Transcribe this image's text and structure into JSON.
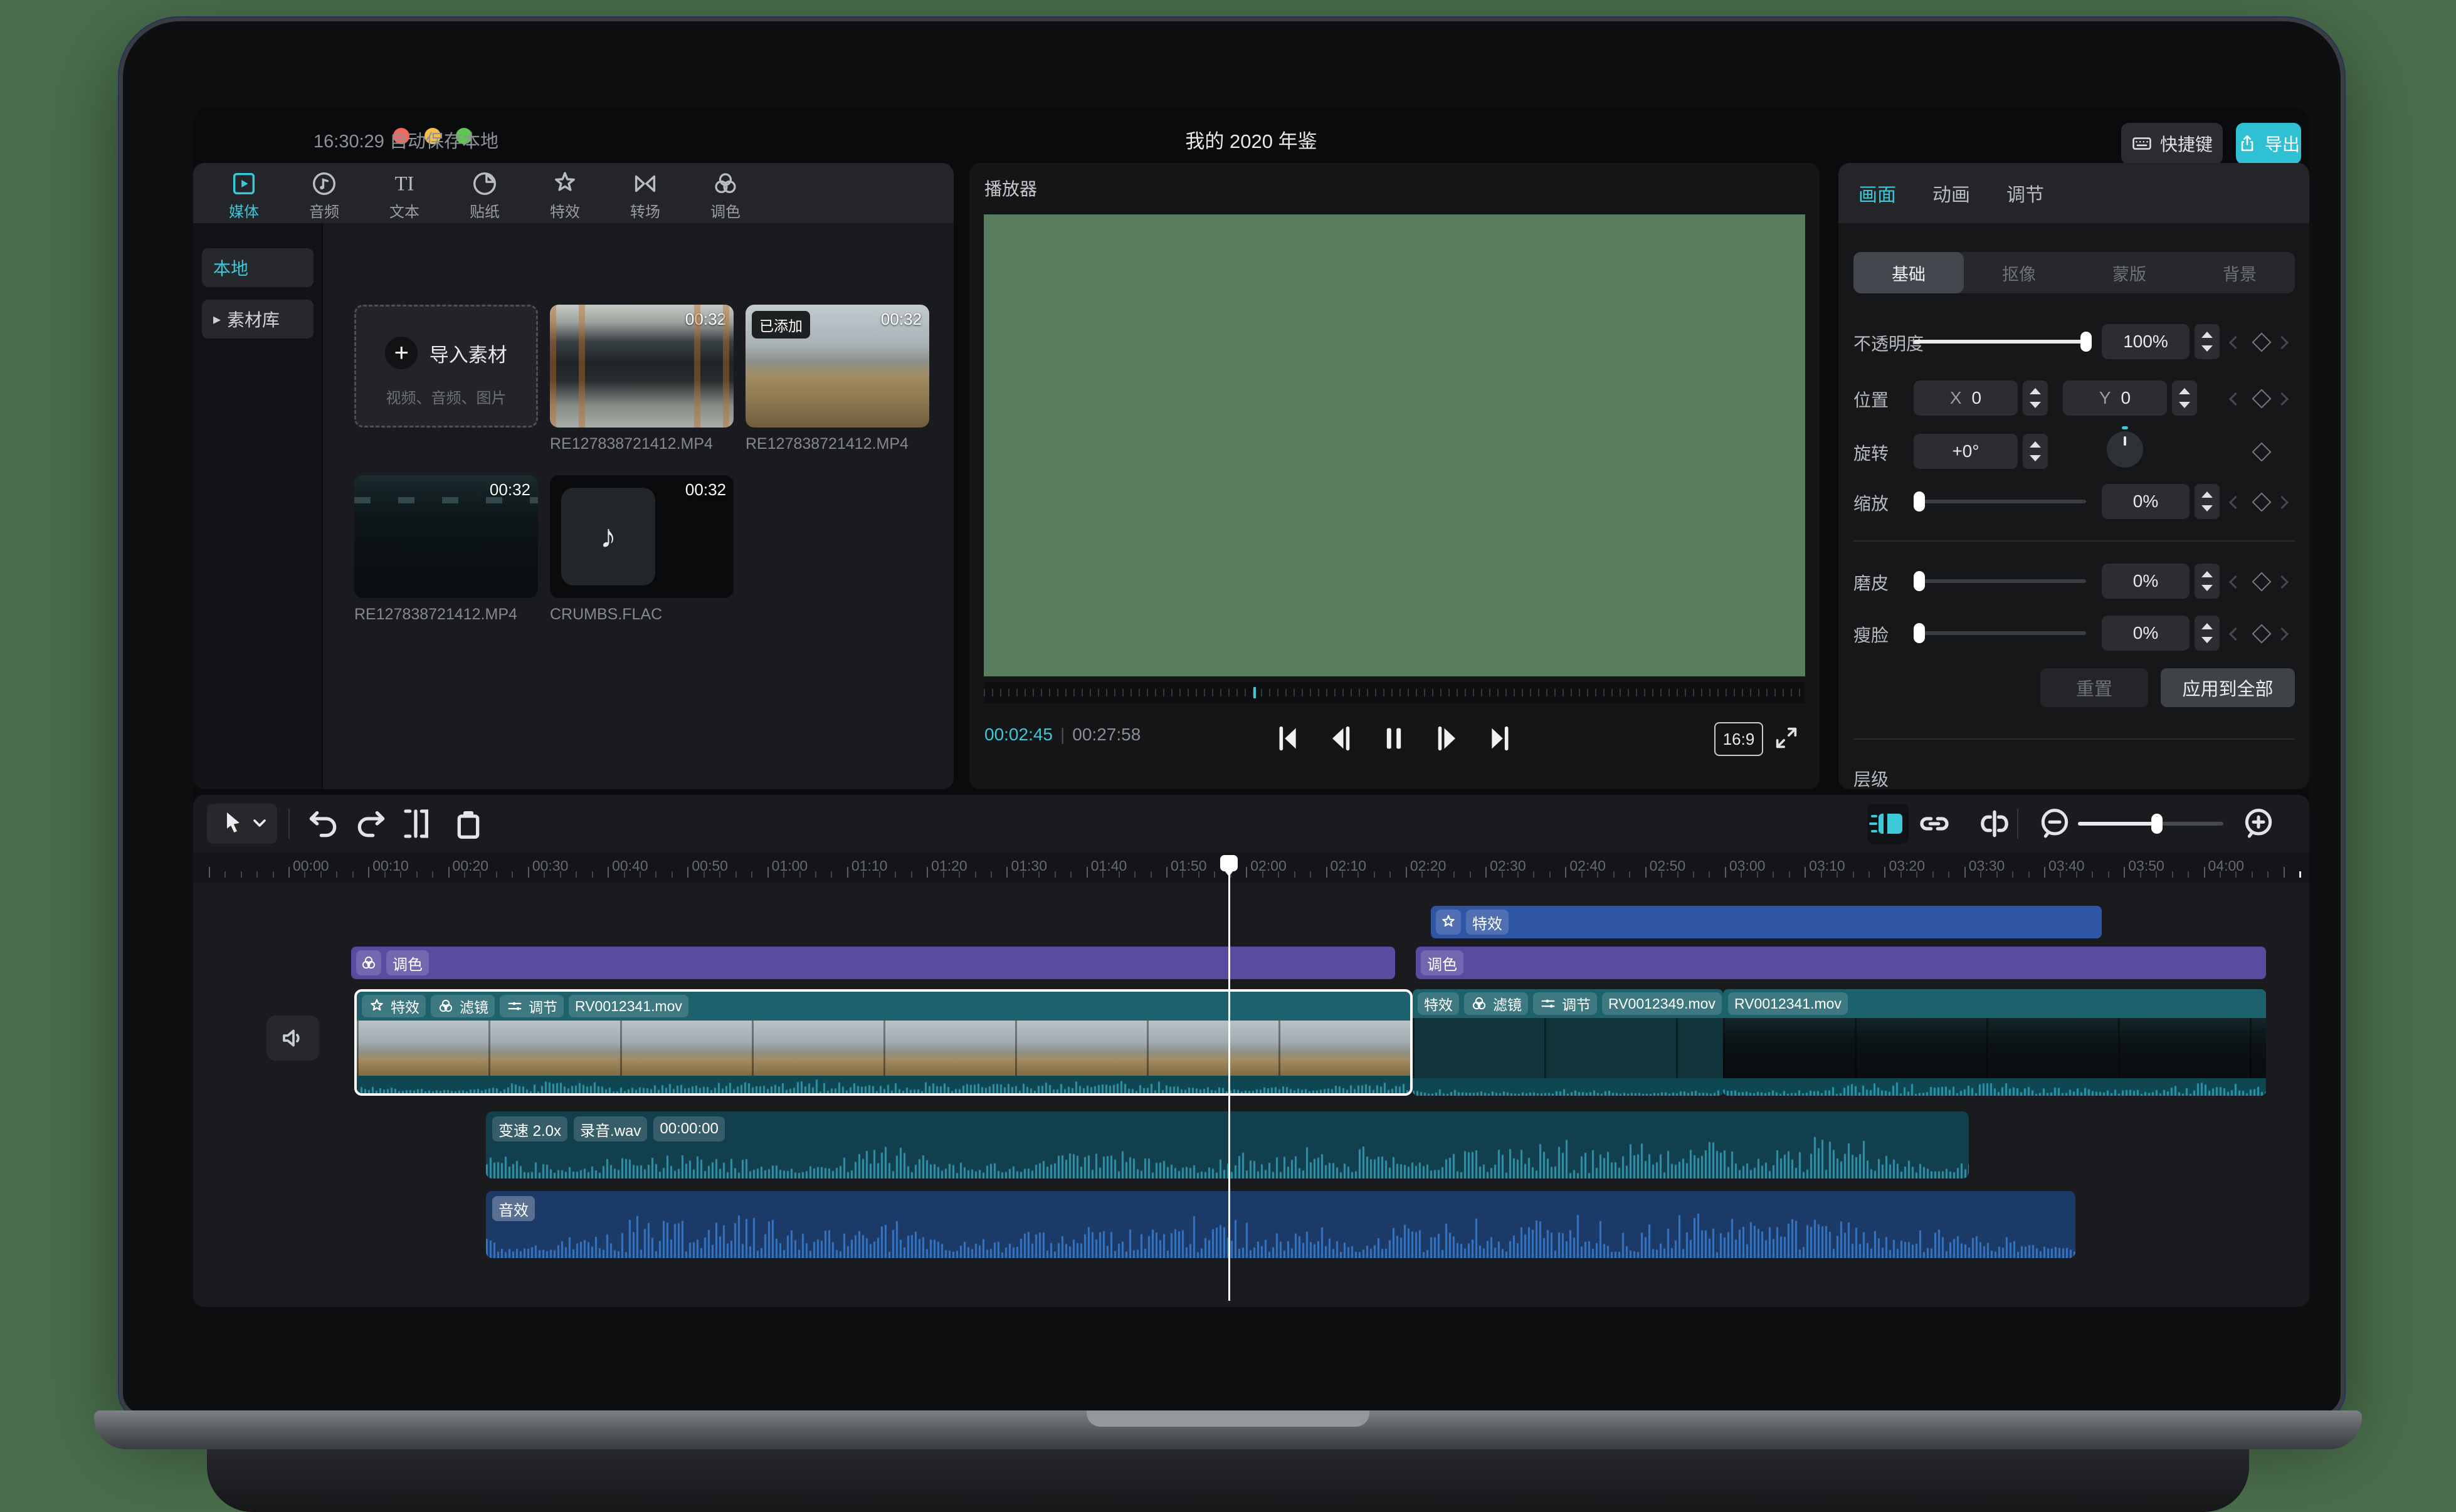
{
  "app": {
    "accent": "#3bc8d8",
    "background": "#4a6e4c"
  },
  "titlebar": {
    "autosave": "16:30:29 自动保存本地",
    "title": "我的 2020 年鉴",
    "shortcuts": {
      "icon": "keyboard-icon",
      "label": "快捷键"
    },
    "export": {
      "icon": "share-up-icon",
      "label": "导出"
    }
  },
  "media": {
    "tabs": [
      {
        "icon": "play-icon",
        "label": "媒体",
        "active": true
      },
      {
        "icon": "music-icon",
        "label": "音频"
      },
      {
        "icon": "text-icon",
        "label": "文本"
      },
      {
        "icon": "sticker-icon",
        "label": "贴纸"
      },
      {
        "icon": "fx-star-icon",
        "label": "特效"
      },
      {
        "icon": "transition-icon",
        "label": "转场"
      },
      {
        "icon": "color-wheels-icon",
        "label": "调色"
      }
    ],
    "sidebar": [
      {
        "label": "本地",
        "active": true
      },
      {
        "label": "素材库",
        "arrow": true
      }
    ],
    "import_card": {
      "icon": "plus-icon",
      "label": "导入素材",
      "hint": "视频、音频、图片"
    },
    "items": [
      {
        "kind": "video",
        "variant": "tunnel",
        "duration": "00:32",
        "name": "RE127838721412.MP4"
      },
      {
        "kind": "video",
        "variant": "flood",
        "duration": "00:32",
        "name": "RE127838721412.MP4",
        "added_badge": "已添加"
      },
      {
        "kind": "video",
        "variant": "garage",
        "duration": "00:32",
        "name": "RE127838721412.MP4"
      },
      {
        "kind": "audio",
        "variant": "audio",
        "duration": "00:32",
        "name": "CRUMBS.FLAC",
        "icon": "music-note-icon",
        "note_glyph": "♪"
      }
    ]
  },
  "player": {
    "title": "播放器",
    "current_time": "00:02:45",
    "total_time": "00:27:58",
    "aspect_ratio": "16:9",
    "transport_icons": [
      "skip-start-icon",
      "prev-frame-icon",
      "pause-icon",
      "next-frame-icon",
      "skip-end-icon"
    ],
    "preview_color": "#587e5e"
  },
  "inspector": {
    "tabs": [
      {
        "label": "画面",
        "active": true
      },
      {
        "label": "动画"
      },
      {
        "label": "调节"
      }
    ],
    "subtabs": [
      {
        "label": "基础",
        "active": true
      },
      {
        "label": "抠像"
      },
      {
        "label": "蒙版"
      },
      {
        "label": "背景"
      }
    ],
    "opacity": {
      "label": "不透明度",
      "value": "100%",
      "slider_pct": 100
    },
    "position": {
      "label": "位置",
      "x_label": "X",
      "x_value": "0",
      "y_label": "Y",
      "y_value": "0"
    },
    "rotation": {
      "label": "旋转",
      "value": "+0°"
    },
    "scale": {
      "label": "缩放",
      "value": "0%",
      "slider_pct": 0
    },
    "smooth_skin": {
      "label": "磨皮",
      "value": "0%",
      "slider_pct": 0
    },
    "slim_face": {
      "label": "瘦脸",
      "value": "0%",
      "slider_pct": 0
    },
    "reset_btn": "重置",
    "apply_all_btn": "应用到全部",
    "layer_label": "层级"
  },
  "timeline": {
    "toolbar_icons": [
      "cursor-icon",
      "chevron-down-icon",
      "undo-icon",
      "redo-icon",
      "split-icon",
      "trash-icon",
      "snap-timeline-icon",
      "link-icon",
      "split-clip-icon",
      "zoom-out-icon",
      "zoom-in-icon"
    ],
    "ruler_labels": [
      "00:00",
      "00:10",
      "00:20",
      "00:30",
      "00:40",
      "00:50",
      "01:00",
      "01:10",
      "01:20",
      "01:30",
      "01:40",
      "01:50",
      "02:00",
      "02:10",
      "02:20",
      "02:30",
      "02:40",
      "02:50",
      "03:00",
      "03:10",
      "03:20",
      "03:30",
      "03:40",
      "03:50",
      "04:00"
    ],
    "effect_clip": {
      "icon": "fx-star-icon",
      "label": "特效",
      "color": "#2f55a5"
    },
    "color_clips": [
      {
        "icon": "color-wheels-icon",
        "label": "调色",
        "color": "#5a4aa0"
      },
      {
        "label": "调色",
        "color": "#5a4aa0"
      }
    ],
    "video_clips": [
      {
        "selected": true,
        "variant": "flood",
        "name": "RV0012341.mov",
        "badges": [
          {
            "icon": "fx-star-icon",
            "label": "特效"
          },
          {
            "icon": "color-wheels-icon",
            "label": "滤镜"
          },
          {
            "icon": "sliders-icon",
            "label": "调节"
          }
        ]
      },
      {
        "variant": "tunnel",
        "name": "RV0012349.mov",
        "badges": [
          {
            "label": "特效"
          },
          {
            "icon": "color-wheels-icon",
            "label": "滤镜"
          },
          {
            "icon": "sliders-icon",
            "label": "调节"
          }
        ]
      },
      {
        "variant": "garage",
        "name": "RV0012341.mov",
        "badges": []
      }
    ],
    "audio_clips": [
      {
        "badges": [
          "变速 2.0x",
          "录音.wav",
          "00:00:00"
        ],
        "color": "teal",
        "mute_icon": "speaker-icon"
      },
      {
        "badges": [
          "音效"
        ],
        "color": "blue"
      }
    ]
  }
}
